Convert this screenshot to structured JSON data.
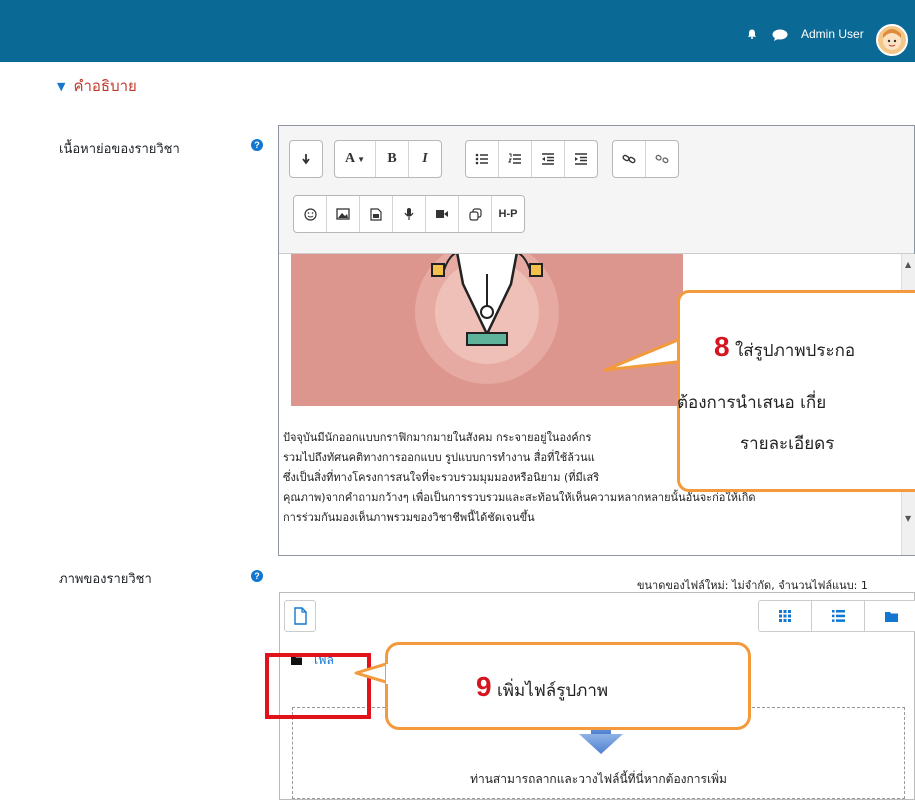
{
  "header": {
    "user_name": "Admin User",
    "icons": [
      "bell-icon",
      "chat-icon",
      "avatar"
    ],
    "bg_color": "#0b6a95"
  },
  "section": {
    "toggle_label": "คำอธิบาย"
  },
  "summary_field": {
    "label": "เนื้อหาย่อของรายวิชา",
    "help": "?"
  },
  "toolbar": {
    "row1": [
      "expand-icon",
      "font-color-icon",
      "bold-icon",
      "italic-icon",
      "unordered-list-icon",
      "ordered-list-icon",
      "outdent-icon",
      "indent-icon",
      "link-icon",
      "unlink-icon"
    ],
    "row2": [
      "emoji-icon",
      "image-icon",
      "media-icon",
      "record-audio-icon",
      "record-video-icon",
      "manage-files-icon",
      "h5p-icon"
    ],
    "font_color_label": "A",
    "bold_label": "B",
    "italic_label": "I",
    "h5p_label": "H-P"
  },
  "editor_text": [
    "ปัจจุบันมีนักออกแบบกราฟิกมากมายในสังคม กระจายอยู่ในองค์กร",
    "รวมไปถึงทัศนคติทางการออกแบบ รูปแบบการทำงาน สื่อที่ใช้ล้วนแ",
    "ซึ่งเป็นสิ่งที่ทางโครงการสนใจที่จะรวบรวมมุมมองหรือนิยาม (ที่มีเสริ",
    "คุณภาพ)จากคำถามกว้างๆ เพื่อเป็นการรวบรวมและสะท้อนให้เห็นความหลากหลายนั้นอันจะก่อให้เกิด",
    "การร่วมกันมองเห็นภาพรวมของวิชาชีพนี้ได้ชัดเจนขึ้น"
  ],
  "callout8": {
    "number": "8",
    "line1": "ใส่รูปภาพประกอ",
    "line2": "ต้องการนำเสนอ เกี่ย",
    "line3": "รายละเอียดร"
  },
  "image_field": {
    "label": "ภาพของรายวิชา",
    "help": "?",
    "meta": "ขนาดของไฟล์ใหม่: ไม่จำกัด, จำนวนไฟล์แนบ: 1",
    "folder_label": "ไฟล์",
    "drop_hint": "ท่านสามารถลากและวางไฟล์นี้ที่นี่หากต้องการเพิ่ม",
    "view_icons": [
      "grid-view-icon",
      "list-view-icon",
      "tree-view-icon"
    ]
  },
  "callout9": {
    "number": "9",
    "text": "เพิ่มไฟล์รูปภาพ"
  },
  "colors": {
    "callout_border": "#f39a3c",
    "callout_number": "#d4141e",
    "highlight_box": "#e2121a",
    "link_blue": "#1177d1"
  }
}
